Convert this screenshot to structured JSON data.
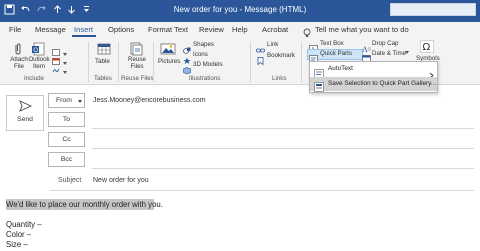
{
  "window": {
    "title": "New order for you  -  Message (HTML)"
  },
  "menu": {
    "tabs": [
      "File",
      "Message",
      "Insert",
      "Options",
      "Format Text",
      "Review",
      "Help",
      "Acrobat"
    ],
    "tell_me": "Tell me what you want to do"
  },
  "ribbon": {
    "attach_file": "Attach\nFile",
    "outlook_item": "Outlook\nItem",
    "business_card": "Business\nCard",
    "calendar": "Calendar",
    "signature": "Signature",
    "table": "Table",
    "reuse_files": "Reuse\nFiles",
    "pictures": "Pictures",
    "shapes": "Shapes",
    "icons": "Icons",
    "models_3d": "3D Models",
    "link": "Link",
    "bookmark": "Bookmark",
    "text_box": "Text Box",
    "quick_parts": "Quick Parts",
    "drop_cap": "Drop Cap",
    "date_time": "Date & Time",
    "symbols": "Symbols",
    "groups": {
      "include": "Include",
      "tables": "Tables",
      "reuse_files": "Reuse Files",
      "illustrations": "Illustrations",
      "links": "Links"
    }
  },
  "quick_parts_menu": {
    "items": [
      "AutoText",
      "Save Selection to Quick Part Gallery..."
    ]
  },
  "header": {
    "send": "Send",
    "from_label": "From",
    "from_value": "Jess.Mooney@encorebusiness.com",
    "to_label": "To",
    "cc_label": "Cc",
    "bcc_label": "Bcc",
    "subject_label": "Subject",
    "subject_value": "New order for you"
  },
  "body": {
    "lines": [
      "We'd like to place our monthly order with you.",
      "Quantity –",
      "Color –",
      "Size –"
    ]
  }
}
